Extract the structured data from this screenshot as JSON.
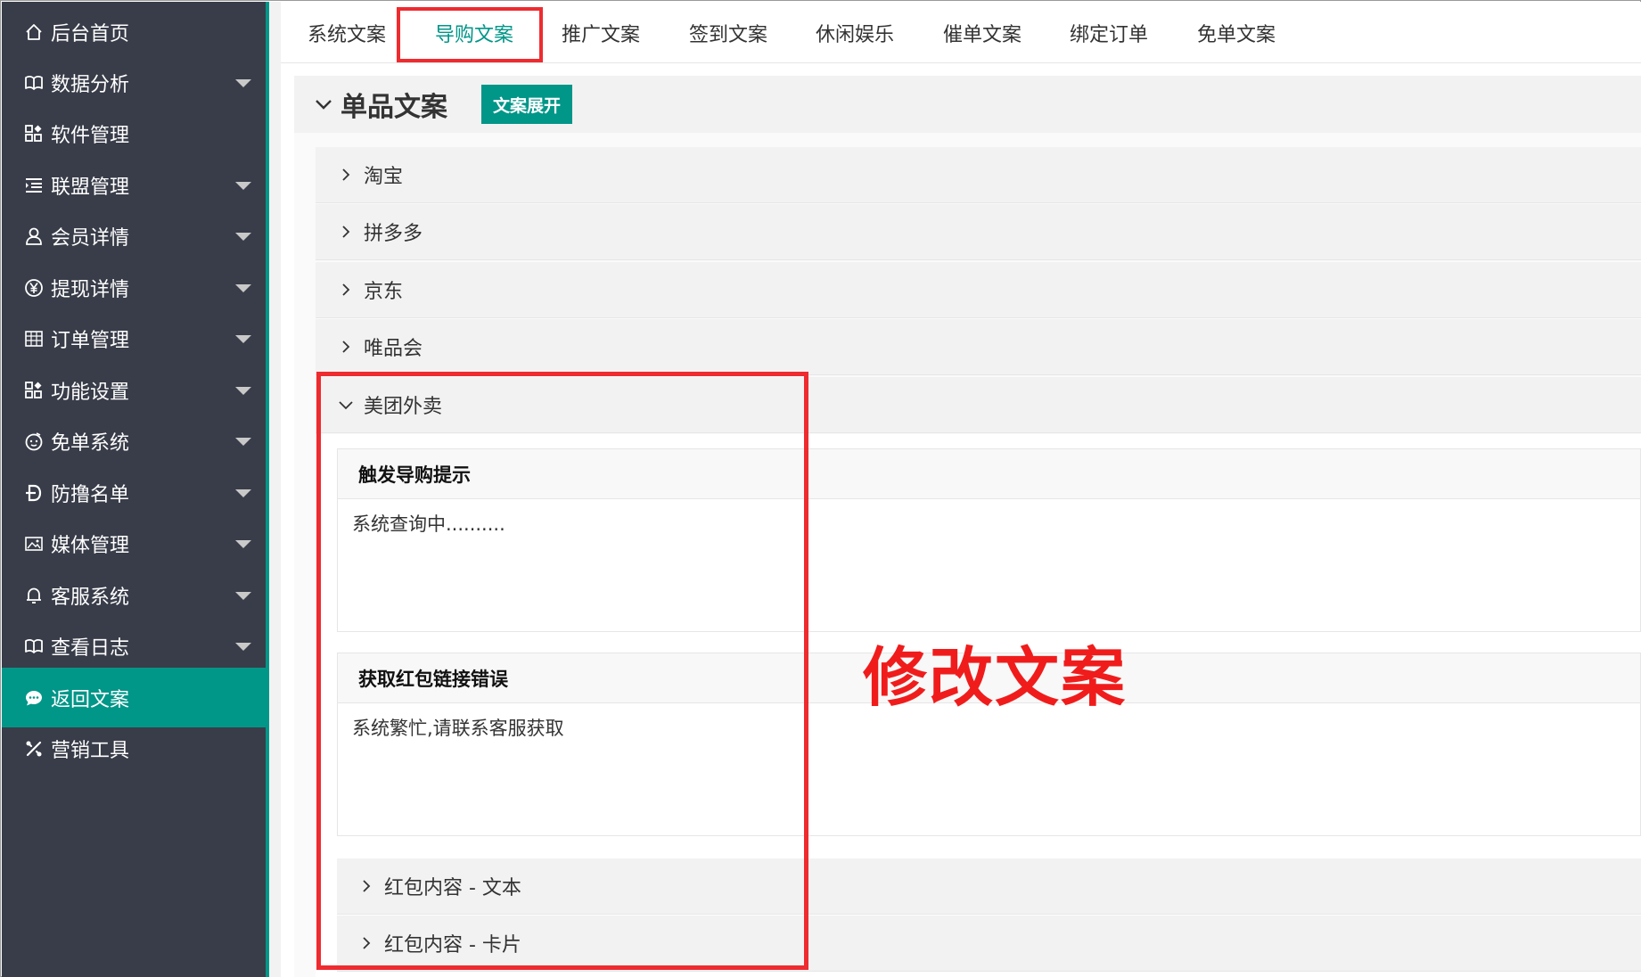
{
  "sidebar": {
    "items": [
      {
        "label": "后台首页",
        "icon": "home-icon",
        "has_caret": false,
        "active": false
      },
      {
        "label": "数据分析",
        "icon": "book-icon",
        "has_caret": true,
        "active": false
      },
      {
        "label": "软件管理",
        "icon": "apps-icon",
        "has_caret": false,
        "active": false
      },
      {
        "label": "联盟管理",
        "icon": "list-indent-icon",
        "has_caret": true,
        "active": false
      },
      {
        "label": "会员详情",
        "icon": "user-icon",
        "has_caret": true,
        "active": false
      },
      {
        "label": "提现详情",
        "icon": "yen-icon",
        "has_caret": true,
        "active": false
      },
      {
        "label": "订单管理",
        "icon": "grid-icon",
        "has_caret": true,
        "active": false
      },
      {
        "label": "功能设置",
        "icon": "apps-icon",
        "has_caret": true,
        "active": false
      },
      {
        "label": "免单系统",
        "icon": "face-icon",
        "has_caret": true,
        "active": false
      },
      {
        "label": "防撸名单",
        "icon": "d-strike-icon",
        "has_caret": true,
        "active": false
      },
      {
        "label": "媒体管理",
        "icon": "image-icon",
        "has_caret": true,
        "active": false
      },
      {
        "label": "客服系统",
        "icon": "bell-icon",
        "has_caret": true,
        "active": false
      },
      {
        "label": "查看日志",
        "icon": "book-icon",
        "has_caret": true,
        "active": false
      },
      {
        "label": "返回文案",
        "icon": "chat-icon",
        "has_caret": false,
        "active": true
      },
      {
        "label": "营销工具",
        "icon": "tools-icon",
        "has_caret": false,
        "active": false
      }
    ]
  },
  "tabs": [
    {
      "label": "系统文案",
      "active": false
    },
    {
      "label": "导购文案",
      "active": true
    },
    {
      "label": "推广文案",
      "active": false
    },
    {
      "label": "签到文案",
      "active": false
    },
    {
      "label": "休闲娱乐",
      "active": false
    },
    {
      "label": "催单文案",
      "active": false
    },
    {
      "label": "绑定订单",
      "active": false
    },
    {
      "label": "免单文案",
      "active": false
    }
  ],
  "section": {
    "title": "单品文案",
    "expand_button": "文案展开"
  },
  "collapse_items": [
    "淘宝",
    "拼多多",
    "京东",
    "唯品会"
  ],
  "open_item": {
    "title": "美团外卖",
    "cards": [
      {
        "heading": "触发导购提示",
        "text": "系统查询中.........."
      },
      {
        "heading": "获取红包链接错误",
        "text": "系统繁忙,请联系客服获取"
      }
    ],
    "sub_items": [
      "红包内容 - 文本",
      "红包内容 - 卡片"
    ]
  },
  "annotation": "修改文案",
  "colors": {
    "sidebar_bg": "#393d49",
    "accent": "#009688",
    "highlight_red": "#ee2b2f"
  }
}
